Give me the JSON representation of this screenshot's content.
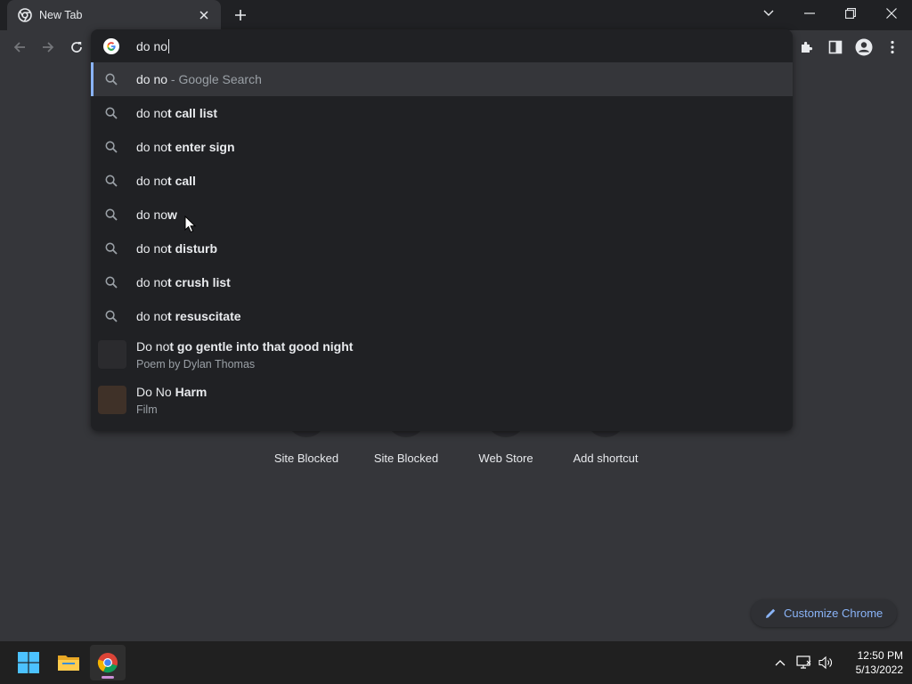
{
  "window": {
    "tab_title": "New Tab"
  },
  "omnibox": {
    "typed_text": "do no",
    "suggestions": [
      {
        "typed": "do no",
        "completion": "",
        "hint": " - Google Search"
      },
      {
        "typed": "do no",
        "completion": "t call list",
        "hint": ""
      },
      {
        "typed": "do no",
        "completion": "t enter sign",
        "hint": ""
      },
      {
        "typed": "do no",
        "completion": "t call",
        "hint": ""
      },
      {
        "typed": "do no",
        "completion": "w",
        "hint": ""
      },
      {
        "typed": "do no",
        "completion": "t disturb",
        "hint": ""
      },
      {
        "typed": "do no",
        "completion": "t crush list",
        "hint": ""
      },
      {
        "typed": "do no",
        "completion": "t resuscitate",
        "hint": ""
      }
    ],
    "entities": [
      {
        "typed": "Do no",
        "completion": "t go gentle into that good night",
        "subtitle": "Poem by Dylan Thomas",
        "thumb_color": "#2b2b2e"
      },
      {
        "typed": "Do No ",
        "completion": "Harm",
        "subtitle": "Film",
        "thumb_color": "#3f3128"
      }
    ]
  },
  "shortcuts": [
    {
      "label": "Site Blocked"
    },
    {
      "label": "Site Blocked"
    },
    {
      "label": "Web Store"
    },
    {
      "label": "Add shortcut"
    }
  ],
  "customize": {
    "label": "Customize Chrome"
  },
  "taskbar": {
    "time": "12:50 PM",
    "date": "5/13/2022"
  },
  "colors": {
    "accent": "#8ab4f8",
    "background": "#35363a",
    "dropdown": "#202124"
  }
}
